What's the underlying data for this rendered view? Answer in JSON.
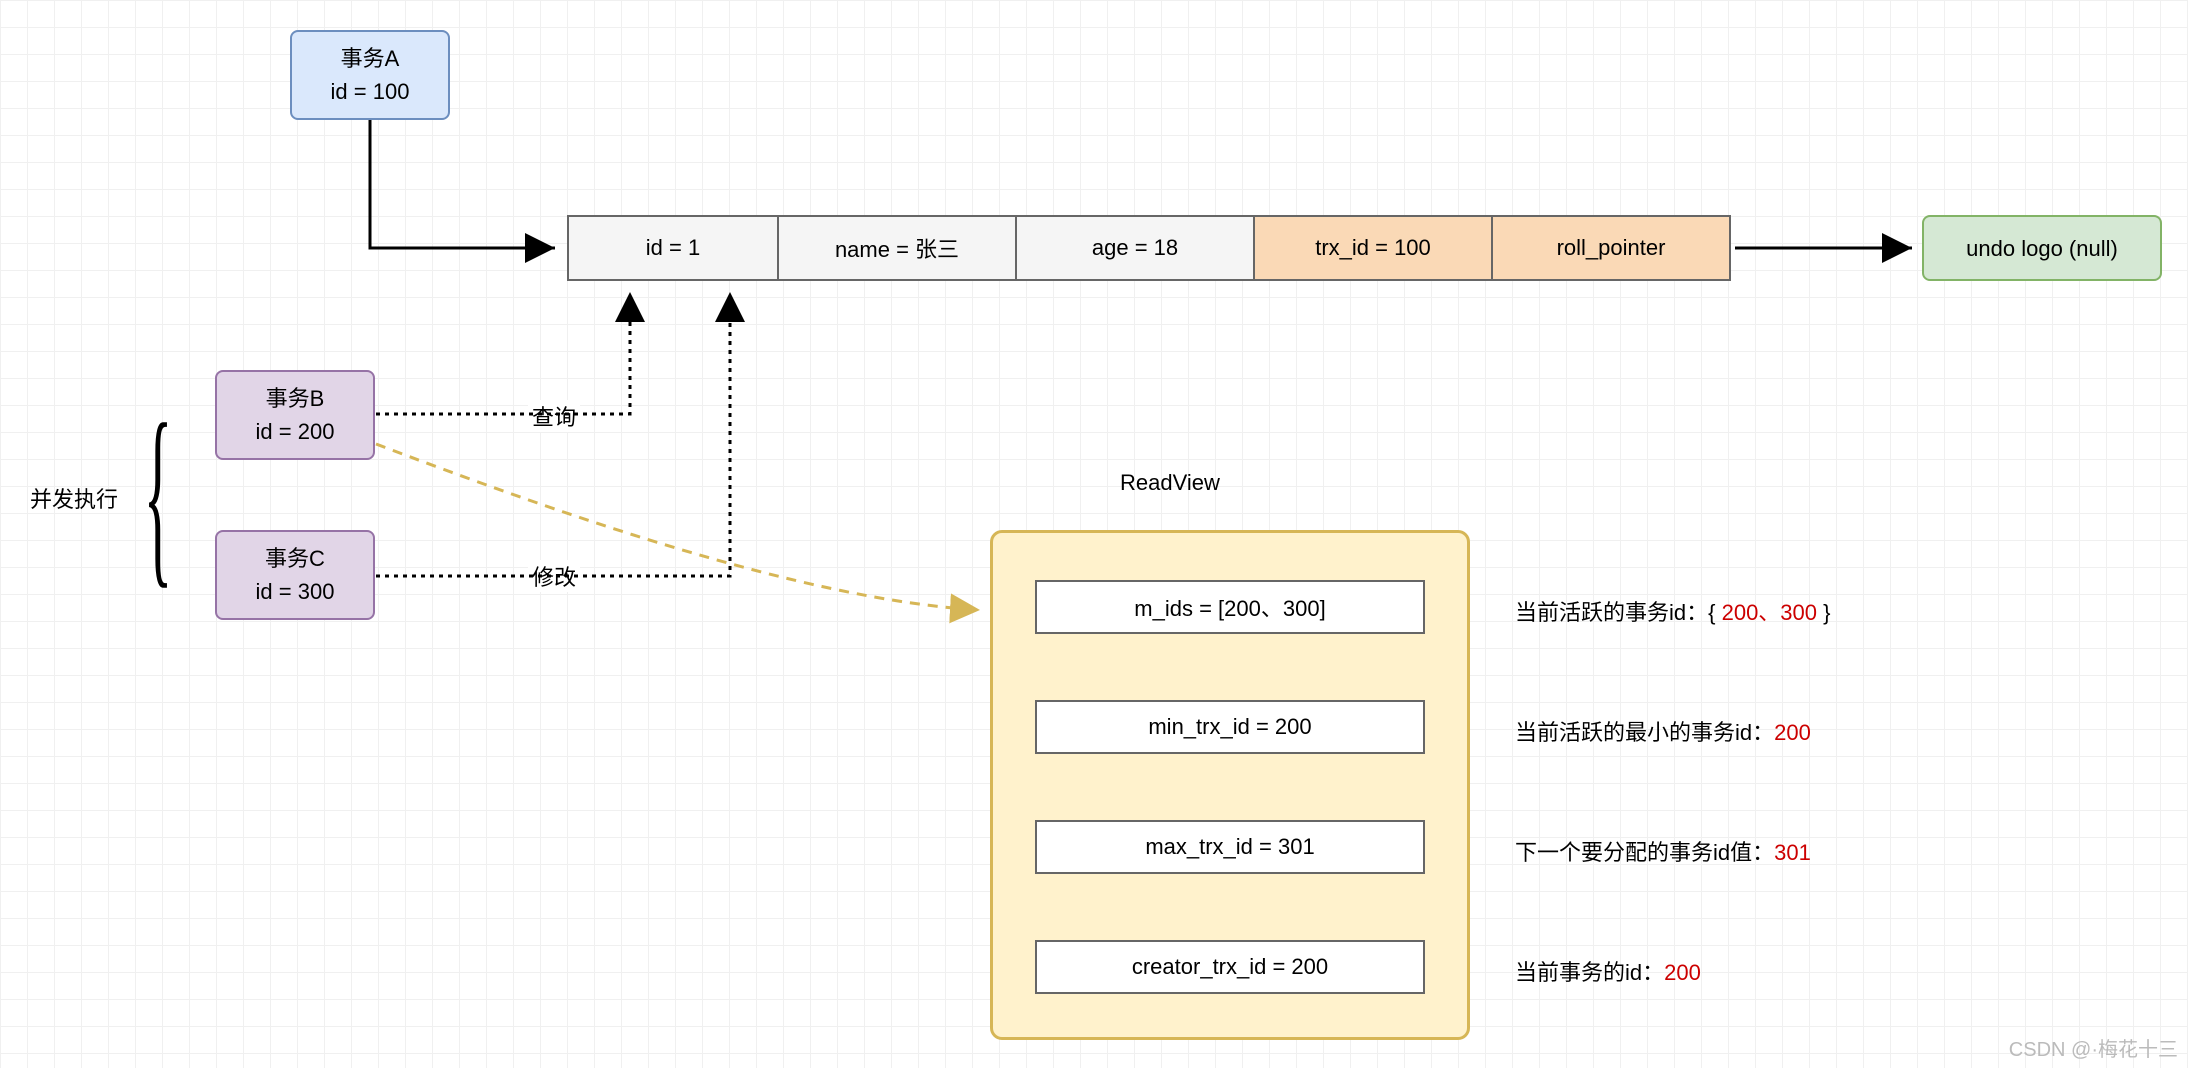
{
  "txA": {
    "title": "事务A",
    "id_label": "id = 100"
  },
  "txB": {
    "title": "事务B",
    "id_label": "id = 200"
  },
  "txC": {
    "title": "事务C",
    "id_label": "id = 300"
  },
  "concurrent_label": "并发执行",
  "query_label": "查询",
  "modify_label": "修改",
  "row": {
    "id": "id = 1",
    "name": "name = 张三",
    "age": "age = 18",
    "trx_id": "trx_id = 100",
    "roll_pointer": "roll_pointer"
  },
  "undo_box": "undo logo (null)",
  "readview": {
    "title": "ReadView",
    "m_ids": "m_ids = [200、300]",
    "min_trx_id": "min_trx_id = 200",
    "max_trx_id": "max_trx_id = 301",
    "creator_trx_id": "creator_trx_id = 200"
  },
  "annotations": {
    "m_ids_prefix": "当前活跃的事务id：{ ",
    "m_ids_val": "200、300",
    "m_ids_suffix": " }",
    "min_prefix": "当前活跃的最小的事务id：",
    "min_val": "200",
    "max_prefix": "下一个要分配的事务id值：",
    "max_val": "301",
    "creator_prefix": "当前事务的id：",
    "creator_val": "200"
  },
  "watermark": "CSDN @·梅花十三"
}
